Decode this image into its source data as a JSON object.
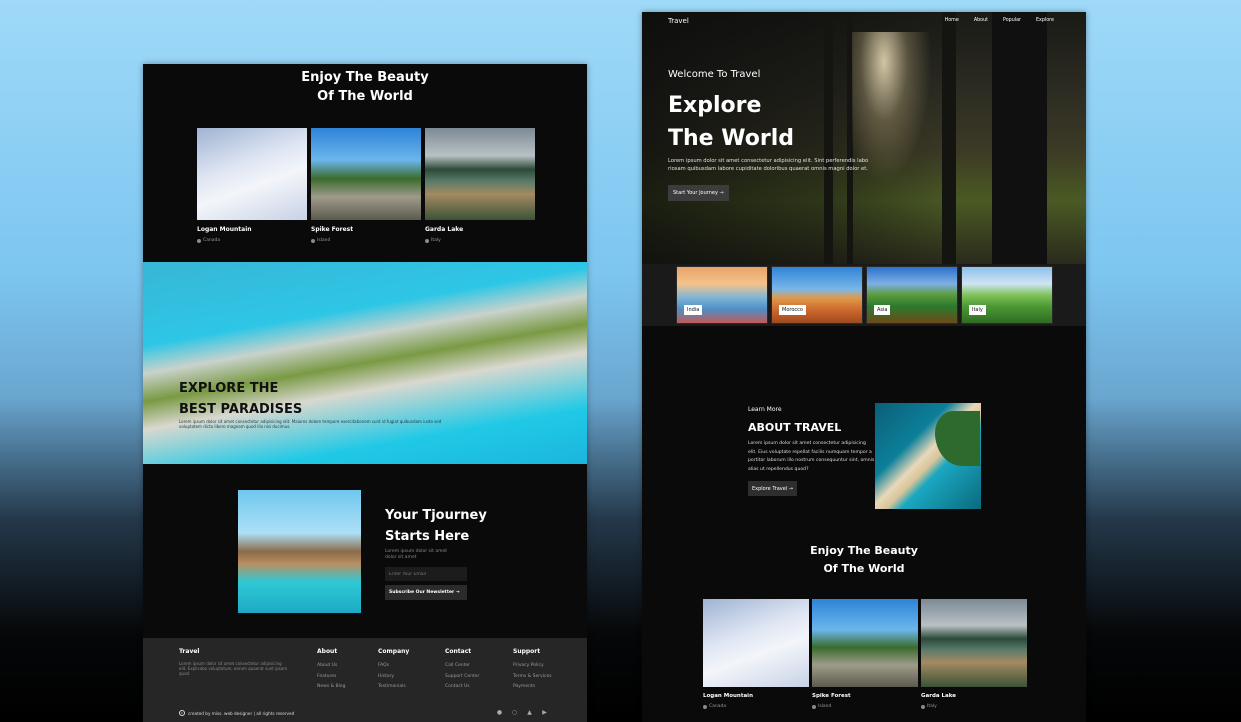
{
  "left": {
    "enjoy": {
      "title": "Enjoy The Beauty\nOf The World",
      "cards": [
        {
          "title": "Logan Mountain",
          "location": "Canada"
        },
        {
          "title": "Spike Forest",
          "location": "Island"
        },
        {
          "title": "Garda Lake",
          "location": "Italy"
        }
      ]
    },
    "banner": {
      "heading": "EXPLORE THE\nBEST PARADISES",
      "text": "Lorem ipsum dolor sit amet consectetur adipisicing elit. Maiores dolore tempore exercitationem sunt id fugiat quibusdam iusto sed voluptatem dicta libero magnam quod illo nisi ducimus."
    },
    "journey": {
      "title": "Your Tjourney\nStarts Here",
      "text": "Lorem ipsum dolor sit amet dolor sit amet",
      "email_placeholder": "Enter Your Email",
      "subscribe_label": "Subscribe Our Newsletter →"
    },
    "footer": {
      "brand": "Travel",
      "brand_text": "Lorem ipsum dolor sit amet consectetur adipisicing elit. Explicabo voluptatum, earum quaerat sunt ipsam quod.",
      "columns": [
        {
          "heading": "About",
          "links": [
            "About Us",
            "Features",
            "News & Blog"
          ]
        },
        {
          "heading": "Company",
          "links": [
            "FAQs",
            "History",
            "Testimonials"
          ]
        },
        {
          "heading": "Contact",
          "links": [
            "Call Center",
            "Support Center",
            "Contact Us"
          ]
        },
        {
          "heading": "Support",
          "links": [
            "Privacy Policy",
            "Terms & Services",
            "Payments"
          ]
        }
      ],
      "copyright_symbol": "c",
      "copyright": "created by miss. web designer | all rights reserved",
      "socials": [
        "facebook-icon",
        "instagram-icon",
        "twitter-icon",
        "youtube-icon"
      ]
    }
  },
  "right": {
    "nav": {
      "brand": "Travel",
      "links": [
        "Home",
        "About",
        "Popular",
        "Explore"
      ]
    },
    "hero": {
      "welcome": "Welcome To Travel",
      "title": "Explore\nThe World",
      "text": "Lorem ipsum dolor sit amet consectetur adipisicing elit. Sint perferendis labo riosam quibusdam labore cupiditate doloribus quaerat omnis magni dolor et.",
      "button": "Start Your Journey →"
    },
    "destinations": [
      "India",
      "Morocco",
      "Asia",
      "Italy"
    ],
    "about": {
      "eyebrow": "Learn More",
      "title": "ABOUT TRAVEL",
      "text": "Lorem ipsum dolor sit amet consectetur adipisicing elit. Eius voluptate repellat facilis numquam tempor a portitor laborum illo nostrum consequuntur sint, omnis alias ut repellendus quod?",
      "button": "Explore Travel →"
    },
    "enjoy": {
      "title": "Enjoy The Beauty\nOf The World",
      "cards": [
        {
          "title": "Logan Mountain",
          "location": "Canada"
        },
        {
          "title": "Spike Forest",
          "location": "Island"
        },
        {
          "title": "Garda Lake",
          "location": "Italy"
        }
      ]
    }
  }
}
